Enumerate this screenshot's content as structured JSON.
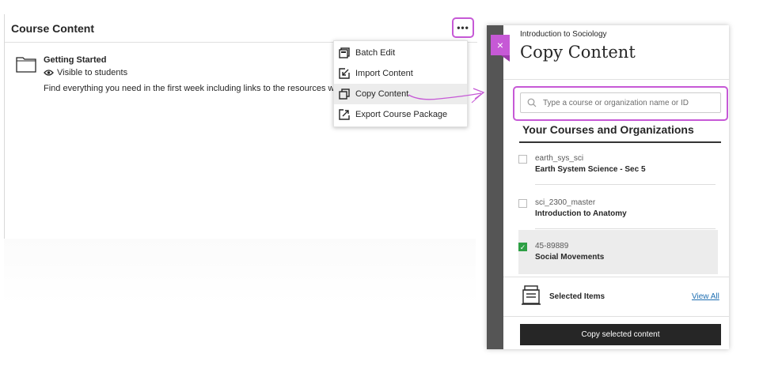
{
  "course_panel": {
    "title": "Course Content",
    "more_button": "•••",
    "item": {
      "title": "Getting Started",
      "visibility": "Visible to students",
      "description": "Find everything you need in the first week including links to the resources we will"
    }
  },
  "menu": {
    "items": [
      {
        "label": "Batch Edit",
        "icon": "batch-edit-icon"
      },
      {
        "label": "Import Content",
        "icon": "import-icon"
      },
      {
        "label": "Copy Content",
        "icon": "copy-icon"
      },
      {
        "label": "Export Course Package",
        "icon": "export-icon"
      }
    ],
    "active_index": 2
  },
  "copy_panel": {
    "close_label": "×",
    "context": "Introduction to Sociology",
    "title": "Copy Content",
    "search_placeholder": "Type a course or organization name or ID",
    "section_heading": "Your Courses and Organizations",
    "courses": [
      {
        "id": "earth_sys_sci",
        "name": "Earth System Science - Sec 5",
        "checked": false
      },
      {
        "id": "sci_2300_master",
        "name": "Introduction to Anatomy",
        "checked": false
      },
      {
        "id": "45-89889",
        "name": "Social Movements",
        "checked": true
      }
    ],
    "selected_items_label": "Selected Items",
    "view_all": "View All",
    "copy_button": "Copy selected content"
  },
  "colors": {
    "highlight": "#c659d6",
    "checked": "#2e9f45",
    "button": "#262626",
    "link": "#1f6fb2"
  }
}
